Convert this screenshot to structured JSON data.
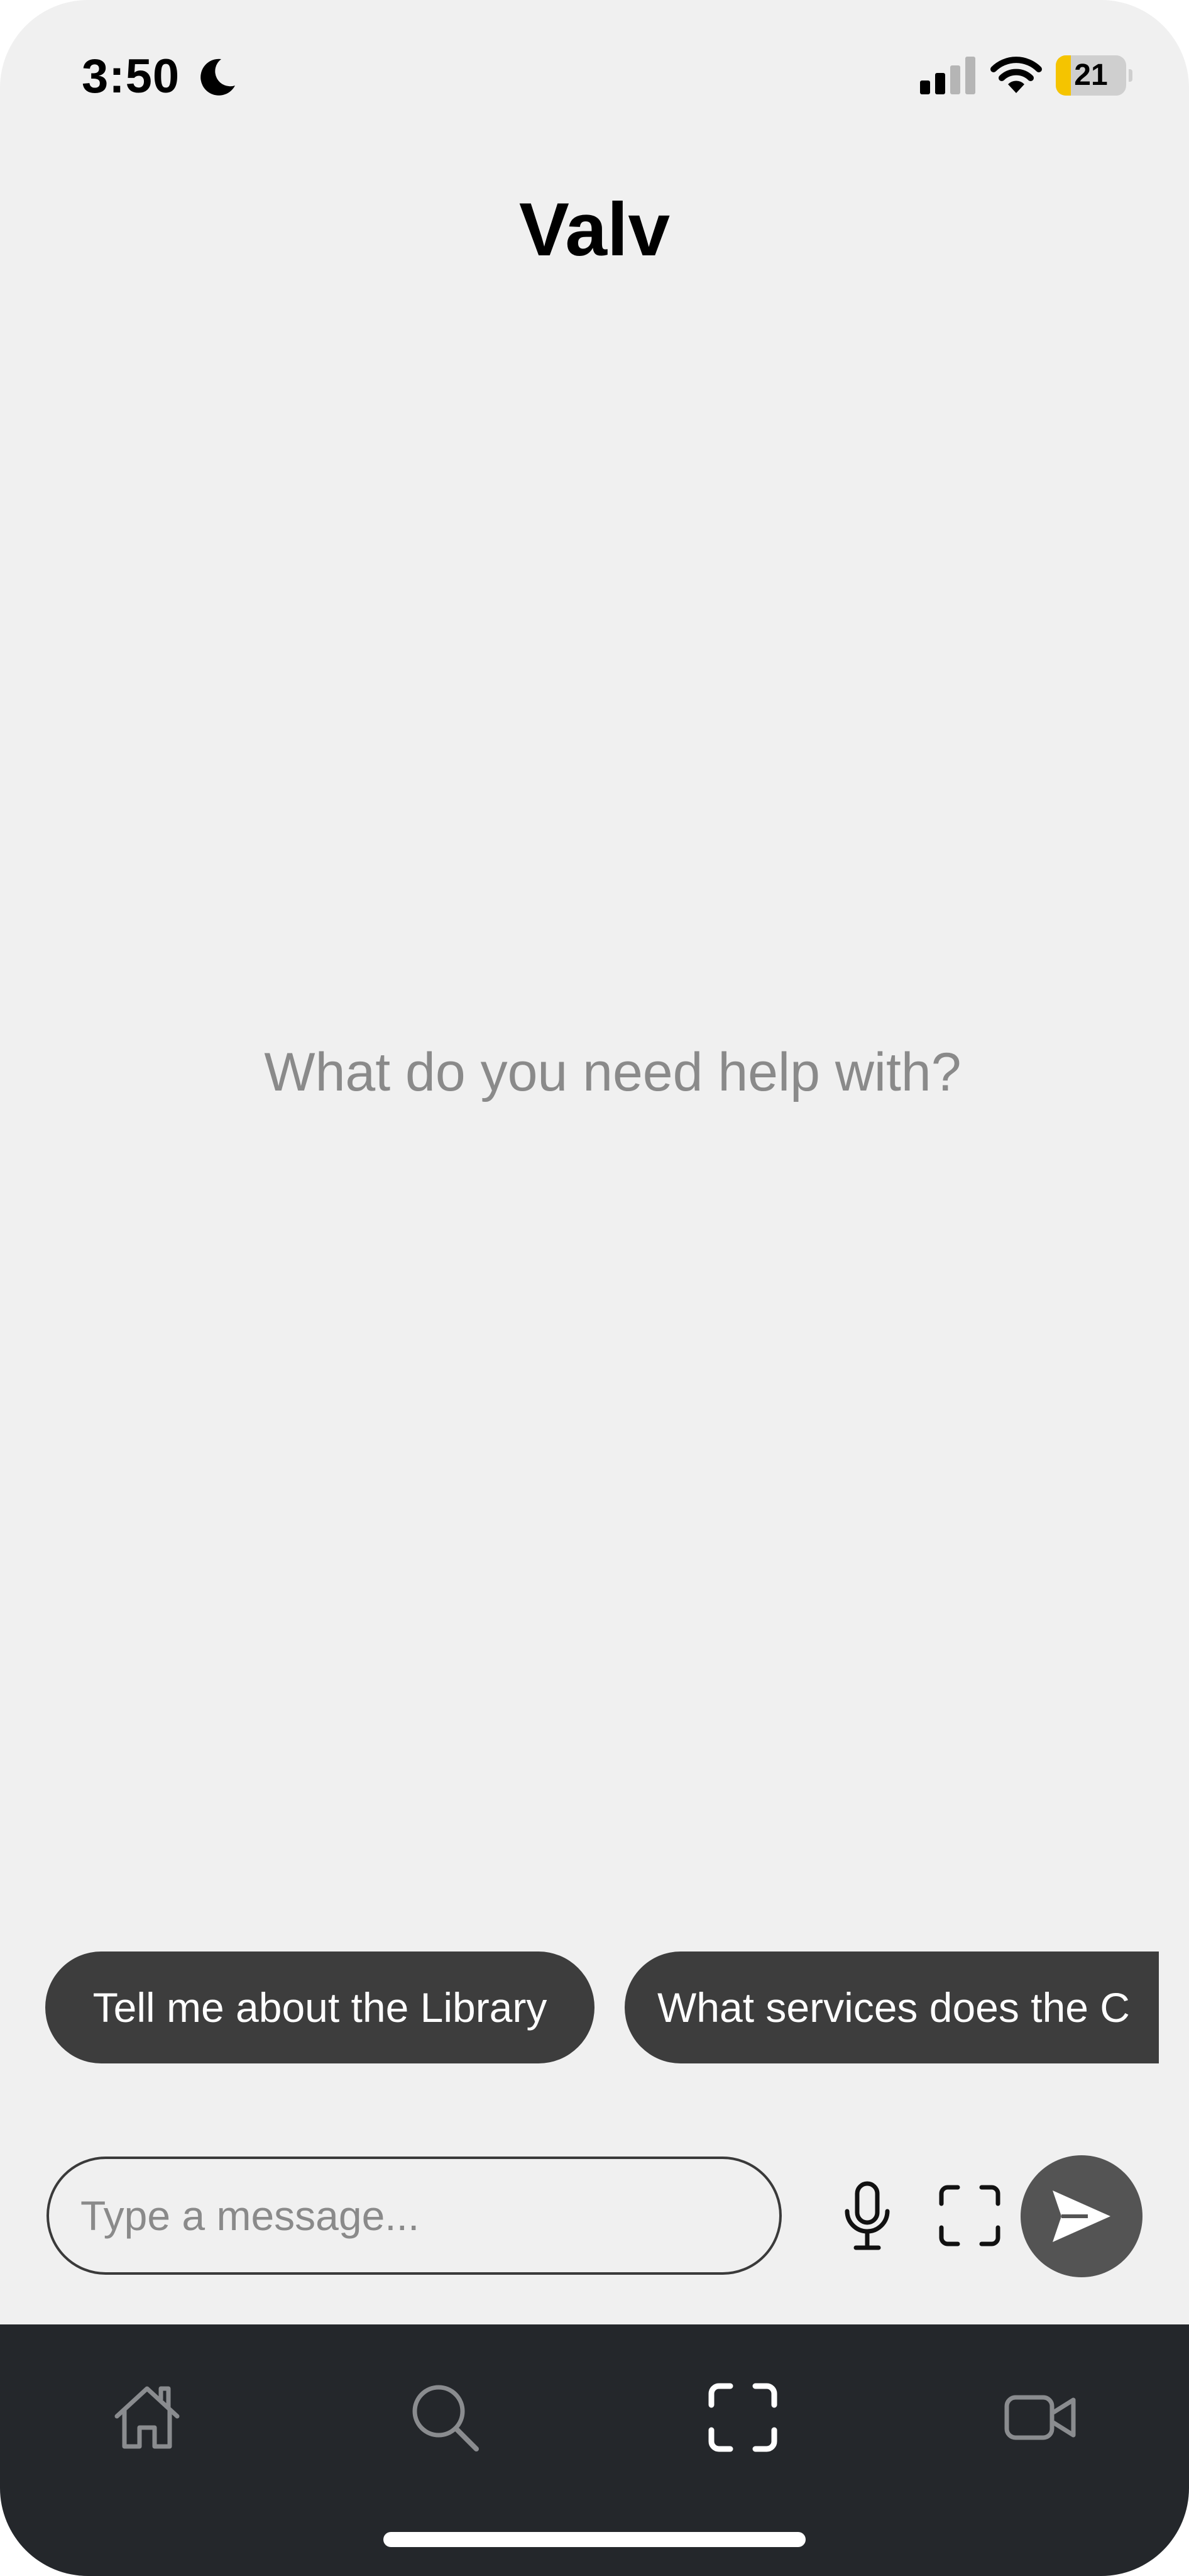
{
  "status_bar": {
    "time": "3:50",
    "battery_level": "21",
    "battery_fraction": 0.21,
    "signal_bars_active": 2,
    "icons": [
      "moon-icon",
      "signal-icon",
      "wifi-icon",
      "battery-icon"
    ]
  },
  "header": {
    "title": "Valv"
  },
  "main": {
    "empty_prompt": "What do you need help with?"
  },
  "suggestions": [
    {
      "label": "Tell me about the Library"
    },
    {
      "label": "What services does the C"
    }
  ],
  "composer": {
    "placeholder": "Type a message...",
    "value": "",
    "icons": [
      "microphone-icon",
      "scan-icon",
      "send-icon"
    ]
  },
  "tab_bar": {
    "tabs": [
      {
        "icon": "home-icon",
        "active": false
      },
      {
        "icon": "search-icon",
        "active": false
      },
      {
        "icon": "scan-icon",
        "active": true
      },
      {
        "icon": "video-camera-icon",
        "active": false
      }
    ]
  },
  "colors": {
    "background": "#f0f0f0",
    "chip": "#3d3d3d",
    "send_button": "#545454",
    "tab_bar": "#24272b",
    "tab_inactive": "#8a8c8f",
    "tab_active": "#ffffff",
    "battery_fill": "#f5c400",
    "prompt_text": "#8a8a8a"
  }
}
